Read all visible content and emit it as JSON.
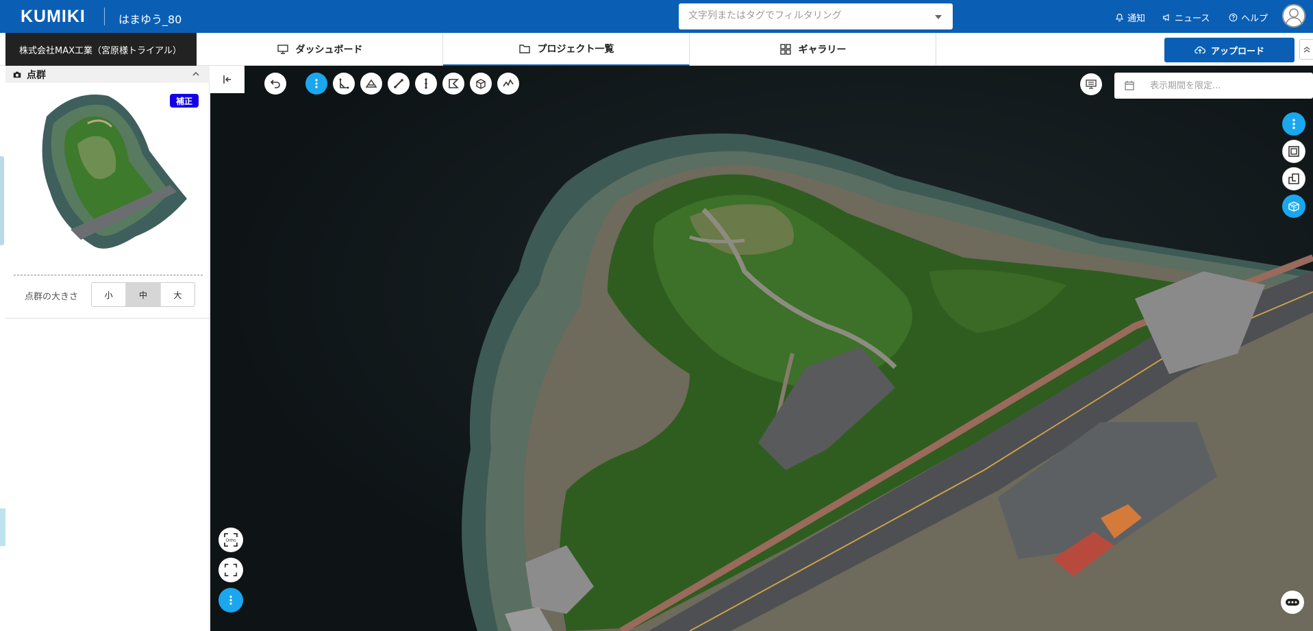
{
  "header": {
    "logo": "KUMIKI",
    "project_name": "はまゆう_80",
    "filter_placeholder": "文字列またはタグでフィルタリング",
    "links": [
      {
        "label": "通知",
        "icon": "bell-icon"
      },
      {
        "label": "ニュース",
        "icon": "megaphone-icon"
      },
      {
        "label": "ヘルプ",
        "icon": "help-circle-icon"
      }
    ]
  },
  "nav": {
    "company": "株式会社MAX工業（宮原様トライアル）",
    "tabs": [
      {
        "label": "ダッシュボード",
        "icon": "monitor-icon"
      },
      {
        "label": "プロジェクト一覧",
        "icon": "folder-icon",
        "active": true
      },
      {
        "label": "ギャラリー",
        "icon": "grid-icon"
      }
    ],
    "upload_label": "アップロード"
  },
  "panel": {
    "title": "点群",
    "badge": "補正",
    "size_label": "点群の大きさ",
    "sizes": [
      "小",
      "中",
      "大"
    ],
    "selected_size": "中"
  },
  "viewer": {
    "date_placeholder": "表示期間を限定...",
    "ortho_label": "Ortho",
    "tools": [
      "undo-icon",
      "more-vertical-icon",
      "angle-measure-icon",
      "area-measure-icon",
      "distance-measure-icon",
      "height-measure-icon",
      "polygon-measure-icon",
      "volume-measure-icon",
      "profile-measure-icon"
    ],
    "right_tools": [
      "more-vertical-icon",
      "frame-icon",
      "layers-icon",
      "pointcloud-icon"
    ]
  },
  "colors": {
    "brand": "#0a5fb5",
    "accent": "#1aa7ee",
    "badge": "#1400e6"
  }
}
